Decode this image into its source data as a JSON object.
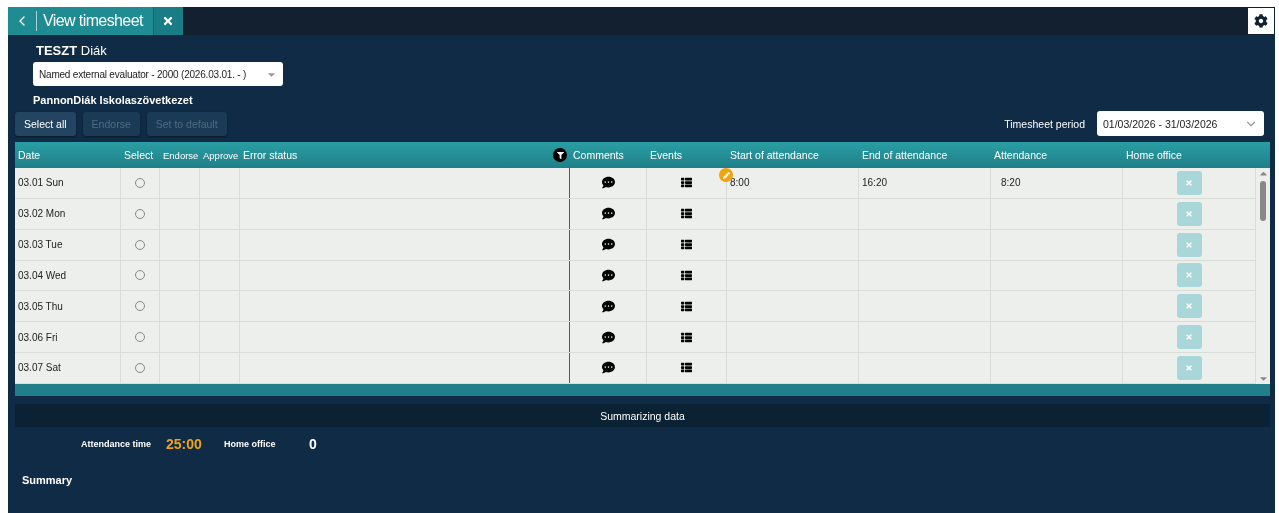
{
  "window": {
    "title": "View timesheet"
  },
  "person": "**TESZT** Diák",
  "contract_select": {
    "value": "Named external evaluator - 2000 (2026.03.01. - )"
  },
  "company": "PannonDiák Iskolaszövetkezet",
  "actions": [
    {
      "label": "Select all",
      "disabled": false
    },
    {
      "label": "Endorse",
      "disabled": true
    },
    {
      "label": "Set to default",
      "disabled": true
    }
  ],
  "period": {
    "label": "Timesheet period",
    "value": "01/03/2026 - 31/03/2026"
  },
  "table": {
    "columns": [
      "Date",
      "Select",
      "Endorse",
      "Approve",
      "Error status",
      "Comments",
      "Events",
      "Start of attendance",
      "End of attendance",
      "Attendance",
      "Home office"
    ],
    "rows": [
      {
        "date": "03.01 Sun",
        "selected": false,
        "edited": true,
        "start": "8:00",
        "end": "16:20",
        "attendance": "8:20",
        "home_office": false
      },
      {
        "date": "03.02 Mon",
        "selected": false,
        "edited": false,
        "home_office": false
      },
      {
        "date": "03.03 Tue",
        "selected": false,
        "edited": false,
        "home_office": false
      },
      {
        "date": "03.04 Wed",
        "selected": false,
        "edited": false,
        "home_office": false
      },
      {
        "date": "03.05 Thu",
        "selected": false,
        "edited": false,
        "home_office": false
      },
      {
        "date": "03.06 Fri",
        "selected": false,
        "edited": false,
        "home_office": false
      },
      {
        "date": "03.07 Sat",
        "selected": false,
        "edited": false,
        "home_office": false
      }
    ]
  },
  "summary_bar": "Summarizing data",
  "totals": [
    {
      "label": "Attendance time",
      "value": "25:00",
      "highlight": true
    },
    {
      "label": "Home office",
      "value": "0",
      "highlight": false
    }
  ],
  "section_title": "Summary"
}
